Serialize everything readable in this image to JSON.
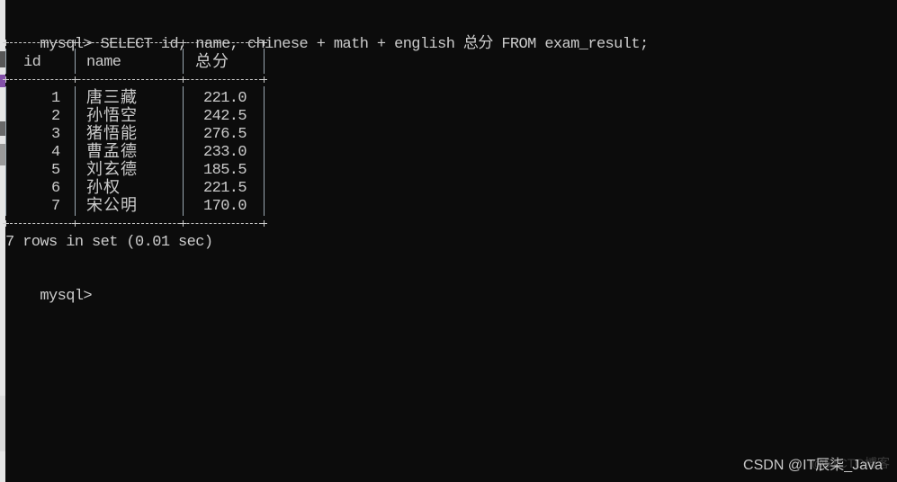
{
  "terminal": {
    "prompt": "mysql>",
    "command": " SELECT id, name, chinese + math + english 总分 FROM exam_result;",
    "table": {
      "headers": [
        "id",
        "name",
        "总分"
      ],
      "rows": [
        {
          "id": "1",
          "name": "唐三藏",
          "total": "221.0"
        },
        {
          "id": "2",
          "name": "孙悟空",
          "total": "242.5"
        },
        {
          "id": "3",
          "name": "猪悟能",
          "total": "276.5"
        },
        {
          "id": "4",
          "name": "曹孟德",
          "total": "233.0"
        },
        {
          "id": "5",
          "name": "刘玄德",
          "total": "185.5"
        },
        {
          "id": "6",
          "name": "孙权",
          "total": "221.5"
        },
        {
          "id": "7",
          "name": "宋公明",
          "total": "170.0"
        }
      ]
    },
    "result_summary": "7 rows in set (0.01 sec)",
    "next_prompt": "mysql>"
  },
  "watermark": {
    "text": "CSDN @IT辰柒_Java",
    "faint_text": "@51CTO博客"
  },
  "colors": {
    "background": "#0c0c0c",
    "foreground": "#cccccc"
  }
}
